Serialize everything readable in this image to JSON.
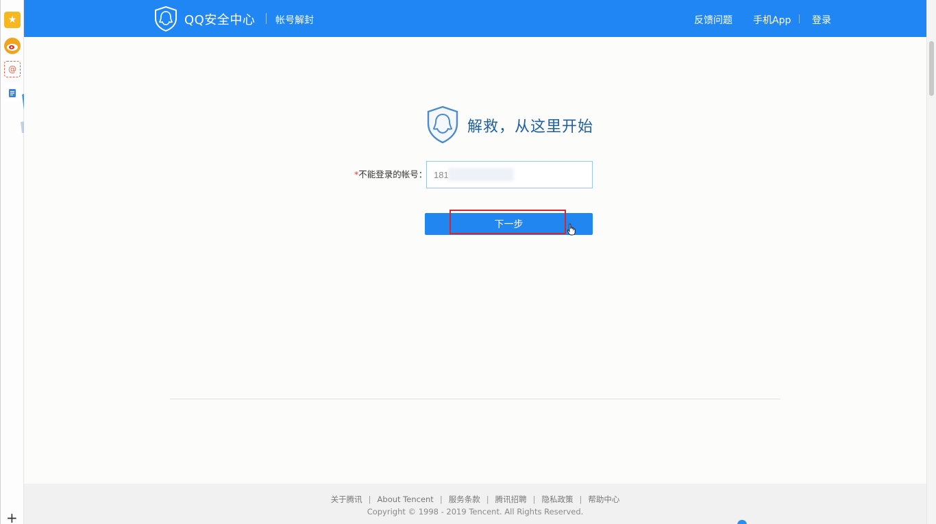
{
  "sidebar": {
    "icons": [
      "star-icon",
      "weibo-icon",
      "mail-icon",
      "document-icon",
      "plus-icon"
    ]
  },
  "header": {
    "brand": "QQ安全中心",
    "subtitle": "帐号解封",
    "nav": {
      "feedback": "反馈问题",
      "app": "手机App",
      "login": "登录"
    }
  },
  "main": {
    "title": "解救，从这里开始",
    "form": {
      "required_mark": "*",
      "label": "不能登录的帐号：",
      "account_value": "181"
    },
    "next_button": "下一步"
  },
  "footer": {
    "links": [
      "关于腾讯",
      "About Tencent",
      "服务条款",
      "腾讯招聘",
      "隐私政策",
      "帮助中心"
    ],
    "copyright": "Copyright © 1998 - 2019 Tencent. All Rights Reserved."
  },
  "colors": {
    "header_bg": "#1f86f3",
    "button_bg": "#2186ef",
    "highlight": "#d6262f",
    "title": "#1f5f9e"
  }
}
